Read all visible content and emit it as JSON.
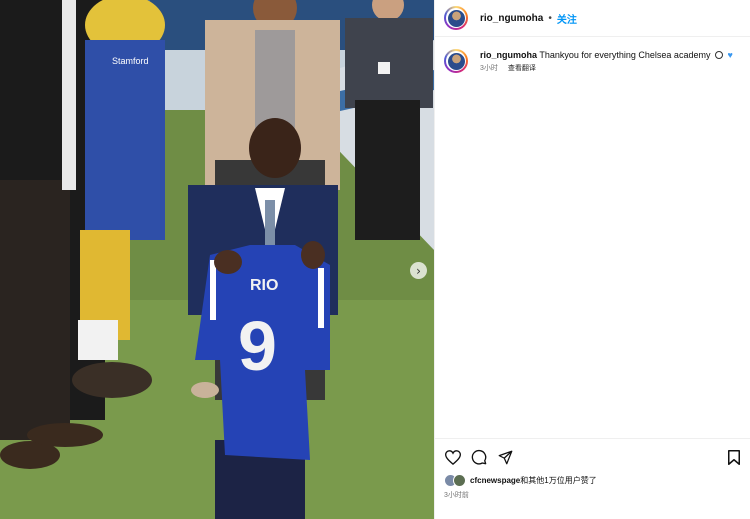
{
  "post": {
    "username": "rio_ngumoha",
    "separator": "•",
    "follow_label": "关注",
    "more_label": "…"
  },
  "caption": {
    "username": "rio_ngumoha",
    "text": "Thankyou for everything Chelsea academy",
    "emojis": [
      "soccer-ball",
      "blue-heart"
    ],
    "time": "3小时",
    "translate_label": "查看翻译"
  },
  "likes": {
    "liker": "cfcnewspage",
    "text": "和其他1万位用户赞了",
    "time": "3小时前"
  },
  "photo": {
    "shirt_name": "RIO",
    "shirt_number": "9",
    "mascot_text": "Stamford"
  },
  "colors": {
    "accent": "#0095f6",
    "grass": "#6c8a44",
    "shirt": "#2543b5"
  }
}
